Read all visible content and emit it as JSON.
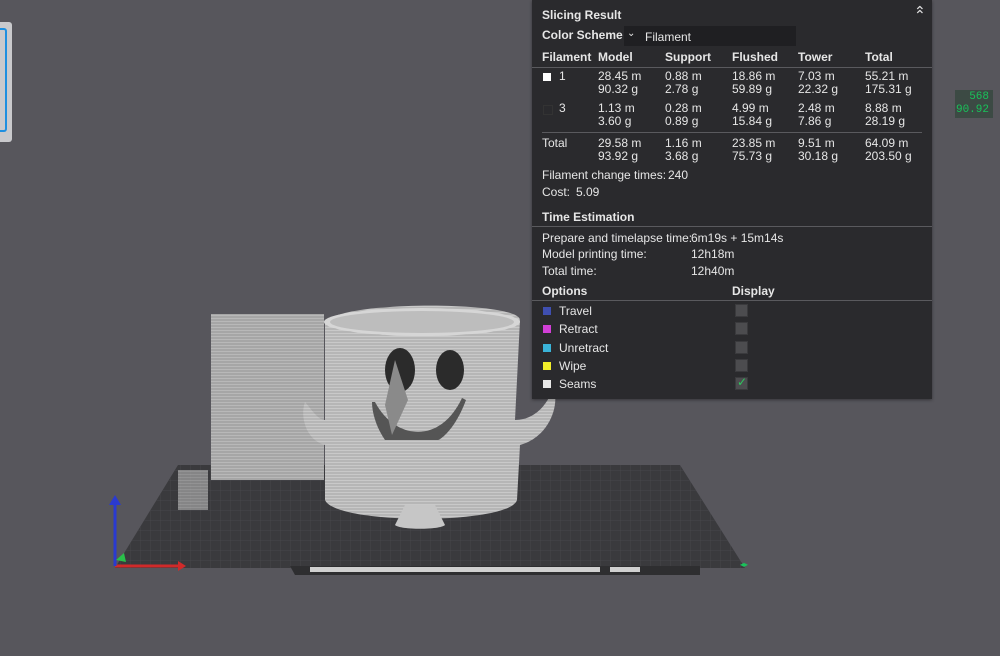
{
  "panel": {
    "title": "Slicing Result",
    "color_scheme_label": "Color Scheme",
    "color_scheme_value": "Filament",
    "table": {
      "headers": [
        "Filament",
        "Model",
        "Support",
        "Flushed",
        "Tower",
        "Total"
      ],
      "rows": [
        {
          "id": "1",
          "swatch": "#ffffff",
          "model": [
            "28.45 m",
            "90.32 g"
          ],
          "support": [
            "0.88 m",
            "2.78 g"
          ],
          "flushed": [
            "18.86 m",
            "59.89 g"
          ],
          "tower": [
            "7.03 m",
            "22.32 g"
          ],
          "total": [
            "55.21 m",
            "175.31 g"
          ]
        },
        {
          "id": "3",
          "swatch": "#2a2a2d",
          "model": [
            "1.13 m",
            "3.60 g"
          ],
          "support": [
            "0.28 m",
            "0.89 g"
          ],
          "flushed": [
            "4.99 m",
            "15.84 g"
          ],
          "tower": [
            "2.48 m",
            "7.86 g"
          ],
          "total": [
            "8.88 m",
            "28.19 g"
          ]
        }
      ],
      "total_row": {
        "label": "Total",
        "model": [
          "29.58 m",
          "93.92 g"
        ],
        "support": [
          "1.16 m",
          "3.68 g"
        ],
        "flushed": [
          "23.85 m",
          "75.73 g"
        ],
        "tower": [
          "9.51 m",
          "30.18 g"
        ],
        "total": [
          "64.09 m",
          "203.50 g"
        ]
      }
    },
    "filament_change_label": "Filament change times:",
    "filament_change_value": "240",
    "cost_label": "Cost:",
    "cost_value": "5.09",
    "time_title": "Time Estimation",
    "time_rows": [
      {
        "label": "Prepare and timelapse time:",
        "value": "6m19s + 15m14s"
      },
      {
        "label": "Model printing time:",
        "value": "12h18m"
      },
      {
        "label": "Total time:",
        "value": "12h40m"
      }
    ],
    "options_header": "Options",
    "display_header": "Display",
    "options": [
      {
        "label": "Travel",
        "color": "#3f4fb0",
        "checked": false
      },
      {
        "label": "Retract",
        "color": "#d13fd6",
        "checked": false
      },
      {
        "label": "Unretract",
        "color": "#3ab3d8",
        "checked": false
      },
      {
        "label": "Wipe",
        "color": "#f2ee2a",
        "checked": false
      },
      {
        "label": "Seams",
        "color": "#e8e8e8",
        "checked": true
      }
    ]
  },
  "layer_indicator": {
    "top": "568",
    "bottom": "90.92"
  },
  "colors": {
    "panel_bg": "#2a2a2d",
    "viewport_bg": "#57565c",
    "accent_green": "#19c25a"
  }
}
